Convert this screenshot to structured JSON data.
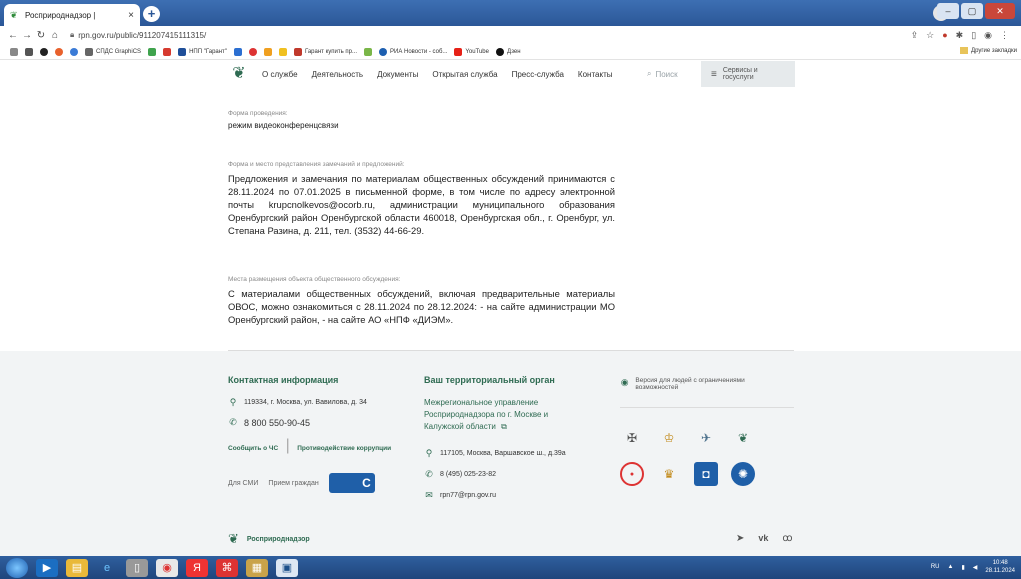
{
  "browser": {
    "tab_title": "Росприроднадзор |",
    "tab_close": "×",
    "new_tab": "+",
    "url": "rpn.gov.ru/public/911207415111315/",
    "bookmarks": [
      "СПДС GraphiCS",
      "НПП \"Гарант\"",
      "Гарант купить пр...",
      "РИА Новости - соб...",
      "YouTube",
      "Дзен"
    ],
    "other_bookmarks": "Другие закладки"
  },
  "site": {
    "menu": [
      "О службе",
      "Деятельность",
      "Документы",
      "Открытая служба",
      "Пресс-служба",
      "Контакты"
    ],
    "search_label": "Поиск",
    "services_label": "Сервисы и госуслуги"
  },
  "content": {
    "s1": {
      "label": "Форма проведения:",
      "value": "режим видеоконференцсвязи"
    },
    "s2": {
      "label": "Форма и место представления замечаний и предложений:",
      "value": "Предложения и замечания по материалам общественных обсуждений принимаются с 28.11.2024 по 07.01.2025 в письменной форме, в том числе по адресу электронной почты krupcnolkevos@ocorb.ru, администрации муниципального образования Оренбургский район Оренбургской области 460018, Оренбургская обл., г. Оренбург, ул. Степана Разина, д. 211, тел. (3532) 44-66-29."
    },
    "s3": {
      "label": "Места размещения объекта общественного обсуждения:",
      "value": "С материалами общественных обсуждений, включая предварительные материалы ОВОС, можно ознакомиться с 28.11.2024 по 28.12.2024: - на сайте администрации МО Оренбургский район, - на сайте АО «НПФ «ДИЭМ»."
    }
  },
  "footer": {
    "contact": {
      "title": "Контактная информация",
      "address": "119334, г. Москва, ул. Вавилова, д. 34",
      "phone": "8 800 550-90-45",
      "link1": "Сообщить о ЧС",
      "link2": "Противодействие коррупции",
      "link3": "Для СМИ",
      "link4": "Прием граждан"
    },
    "territorial": {
      "title": "Ваш территориальный орган",
      "org": "Межрегиональное управление Росприроднадзора по г. Москве и Калужской области",
      "address": "117105, Москва, Варшавское ш., д.39а",
      "phone": "8 (495) 025-23-82",
      "email": "rpn77@rpn.gov.ru"
    },
    "accessibility": "Версия для людей с ограничениями возможностей",
    "brand": "Росприроднадзор"
  },
  "taskbar": {
    "lang": "RU",
    "time": "10:48",
    "date": "28.11.2024"
  }
}
